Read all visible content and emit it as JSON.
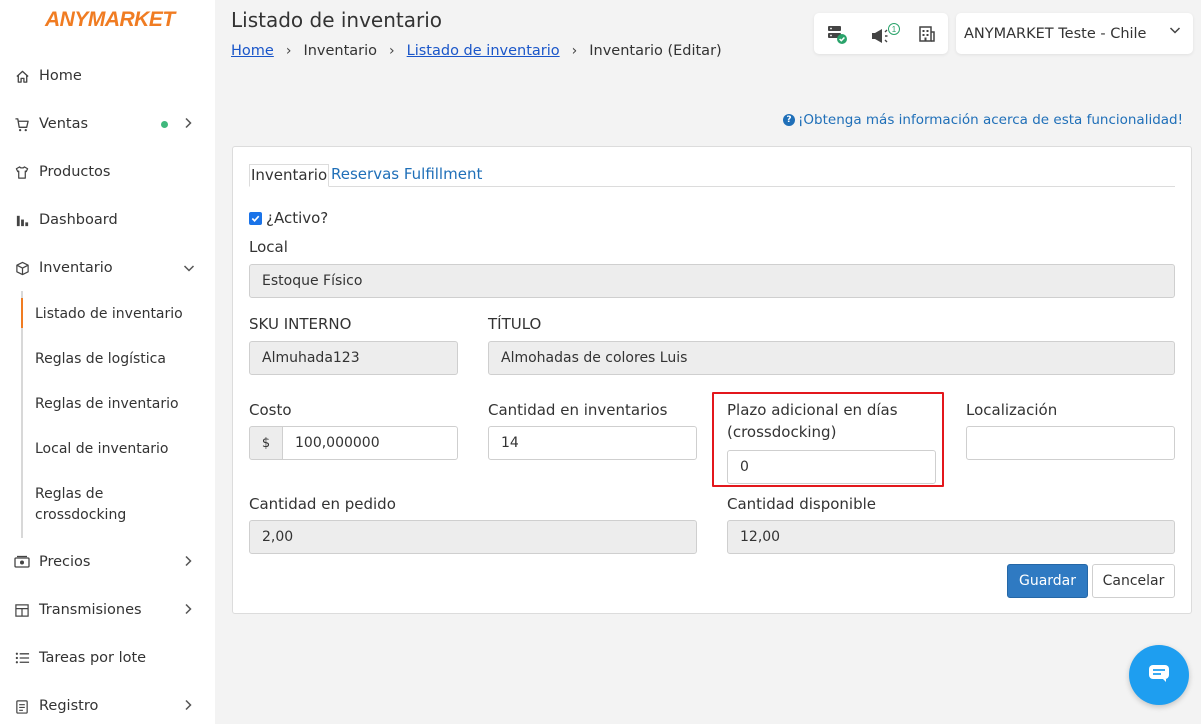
{
  "brand": {
    "logo_text": "ANYMARKET",
    "accent": "#f07c22"
  },
  "sidebar": {
    "items": [
      {
        "label": "Home",
        "icon": "home-icon"
      },
      {
        "label": "Ventas",
        "icon": "cart-icon",
        "status_dot": "#3fb87c"
      },
      {
        "label": "Productos",
        "icon": "shirt-icon"
      },
      {
        "label": "Dashboard",
        "icon": "bar-chart-icon"
      },
      {
        "label": "Inventario",
        "icon": "box-icon",
        "expanded": true
      },
      {
        "label": "Precios",
        "icon": "price-tag-icon"
      },
      {
        "label": "Transmisiones",
        "icon": "transmission-icon"
      },
      {
        "label": "Tareas por lote",
        "icon": "list-icon"
      },
      {
        "label": "Registro",
        "icon": "clipboard-icon"
      }
    ],
    "inventory_sub": [
      {
        "label": "Listado de inventario",
        "active": true
      },
      {
        "label": "Reglas de logística"
      },
      {
        "label": "Reglas de inventario"
      },
      {
        "label": "Local de inventario"
      },
      {
        "label": "Reglas de crossdocking"
      }
    ]
  },
  "header": {
    "title": "Listado de inventario",
    "breadcrumb": [
      {
        "label": "Home",
        "link": true
      },
      {
        "label": "Inventario",
        "link": false
      },
      {
        "label": "Listado de inventario",
        "link": true
      },
      {
        "label": "Inventario (Editar)",
        "link": false
      }
    ],
    "notification_count": "1",
    "account": "ANYMARKET Teste - Chile"
  },
  "help_text": "¡Obtenga más información acerca de esta funcionalidad!",
  "tabs": [
    {
      "label": "Inventario",
      "active": true
    },
    {
      "label": "Reservas Fulfillment",
      "active": false
    }
  ],
  "form": {
    "active_label": "¿Activo?",
    "active_checked": true,
    "local_label": "Local",
    "local_value": "Estoque Físico",
    "sku_label": "SKU INTERNO",
    "sku_value": "Almuhada123",
    "title_label": "TÍTULO",
    "title_value": "Almohadas de colores Luis",
    "cost_label": "Costo",
    "cost_prefix": "$",
    "cost_value": "100,000000",
    "qty_label": "Cantidad en inventarios",
    "qty_value": "14",
    "crossdock_label_1": "Plazo adicional en días",
    "crossdock_label_2": "(crossdocking)",
    "crossdock_value": "0",
    "location_label": "Localización",
    "location_value": "",
    "ordered_label": "Cantidad en pedido",
    "ordered_value": "2,00",
    "available_label": "Cantidad disponible",
    "available_value": "12,00"
  },
  "buttons": {
    "save": "Guardar",
    "cancel": "Cancelar"
  },
  "colors": {
    "primary": "#2f7ac2",
    "link": "#1f6fb8",
    "highlight": "#e3171c",
    "chat": "#1e9ef0"
  }
}
